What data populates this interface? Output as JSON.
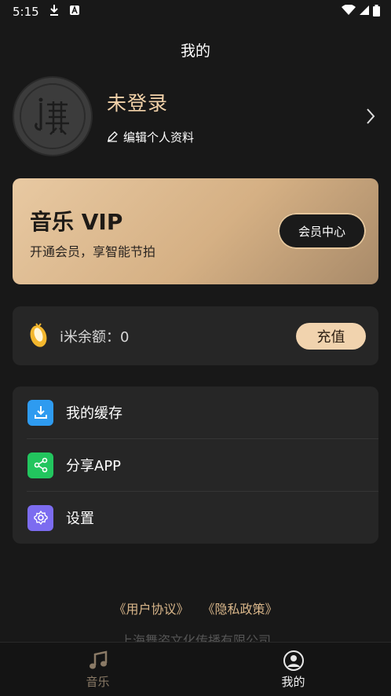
{
  "status_bar": {
    "time": "5:15"
  },
  "header": {
    "title": "我的"
  },
  "profile": {
    "name": "未登录",
    "edit_label": "编辑个人资料"
  },
  "vip": {
    "title": "音乐 VIP",
    "subtitle": "开通会员，享智能节拍",
    "button": "会员中心"
  },
  "balance": {
    "label": "i米余额：0",
    "button": "充值"
  },
  "menu": [
    {
      "label": "我的缓存",
      "icon": "download-icon",
      "color": "#2e9bf0"
    },
    {
      "label": "分享APP",
      "icon": "share-icon",
      "color": "#22c55e"
    },
    {
      "label": "设置",
      "icon": "gear-icon",
      "color": "#7c6cf0"
    }
  ],
  "footer": {
    "user_agreement": "《用户协议》",
    "privacy_policy": "《隐私政策》",
    "company": "上海舞姿文化传播有限公司"
  },
  "nav": [
    {
      "label": "音乐",
      "icon": "music-note-icon",
      "active": false
    },
    {
      "label": "我的",
      "icon": "user-icon",
      "active": true
    }
  ],
  "colors": {
    "accent_gold": "#f2d2a9",
    "background": "#181818",
    "card": "#262626"
  }
}
